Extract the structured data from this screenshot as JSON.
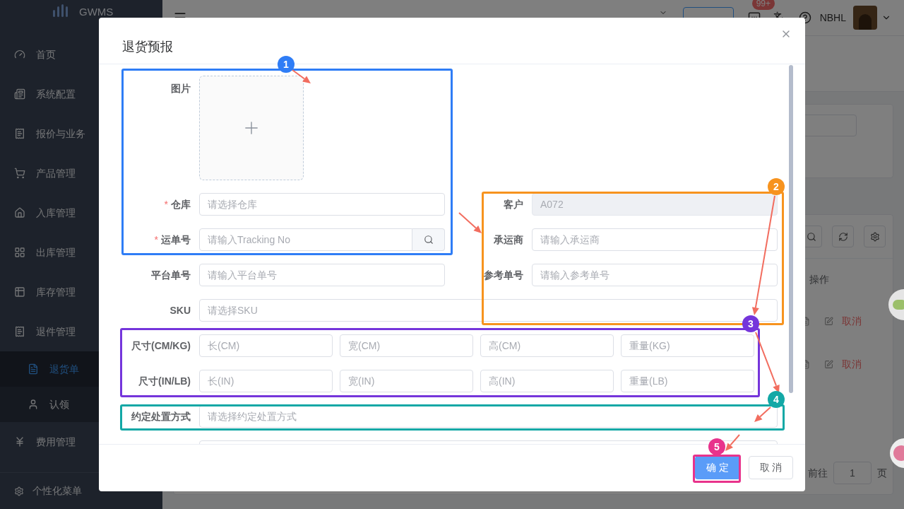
{
  "sidebar": {
    "logo": "GWMS",
    "items": [
      {
        "label": "首页",
        "selected": false
      },
      {
        "label": "系统配置",
        "selected": false
      },
      {
        "label": "报价与业务",
        "selected": false
      },
      {
        "label": "产品管理",
        "selected": false
      },
      {
        "label": "入库管理",
        "selected": false
      },
      {
        "label": "出库管理",
        "selected": false
      },
      {
        "label": "库存管理",
        "selected": false
      },
      {
        "label": "退件管理",
        "selected": false,
        "children": [
          {
            "label": "退货单",
            "selected": true
          },
          {
            "label": "认领",
            "selected": false
          }
        ]
      },
      {
        "label": "费用管理",
        "selected": false
      }
    ],
    "footer": "个性化菜单"
  },
  "header": {
    "badge": "99+",
    "user": "NBHL"
  },
  "page": {
    "table_column": "操作",
    "rows": [
      {
        "action": "取消"
      },
      {
        "action": "取消"
      }
    ],
    "pagination": {
      "goto_label": "前往",
      "page": "1",
      "suffix": "页"
    }
  },
  "dialog": {
    "title": "退货预报",
    "upload_label": "图片",
    "left_fields": [
      {
        "kind": "input",
        "label": "仓库",
        "required_mark": "*",
        "placeholder": "请选择仓库",
        "disabled": false
      },
      {
        "kind": "search",
        "label": "运单号",
        "required_mark": "*",
        "placeholder": "请输入Tracking No",
        "disabled": false
      },
      {
        "kind": "input",
        "label": "平台单号",
        "placeholder": "请输入平台单号",
        "disabled": false
      }
    ],
    "right_fields": [
      {
        "kind": "input",
        "label": "客户",
        "value": "A072",
        "disabled": true
      },
      {
        "kind": "input",
        "label": "承运商",
        "placeholder": "请输入承运商",
        "disabled": false
      },
      {
        "kind": "input",
        "label": "参考单号",
        "placeholder": "请输入参考单号",
        "disabled": false
      }
    ],
    "sku": {
      "label": "SKU",
      "placeholder": "请选择SKU"
    },
    "size_rows": [
      {
        "label": "尺寸(CM/KG)",
        "placeholders": [
          "长(CM)",
          "宽(CM)",
          "高(CM)",
          "重量(KG)"
        ]
      },
      {
        "label": "尺寸(IN/LB)",
        "placeholders": [
          "长(IN)",
          "宽(IN)",
          "高(IN)",
          "重量(LB)"
        ]
      }
    ],
    "disposal": {
      "label": "约定处置方式",
      "placeholder": "请选择约定处置方式"
    },
    "buttons": [
      {
        "kind": "primary",
        "label": "确 定"
      },
      {
        "kind": "default",
        "label": "取 消"
      }
    ]
  },
  "annotations": [
    {
      "number": "1",
      "color": "#2f7df6"
    },
    {
      "number": "2",
      "color": "#f7931e"
    },
    {
      "number": "3",
      "color": "#7535db"
    },
    {
      "number": "4",
      "color": "#13a8a6"
    },
    {
      "number": "5",
      "color": "#e8338c"
    }
  ]
}
